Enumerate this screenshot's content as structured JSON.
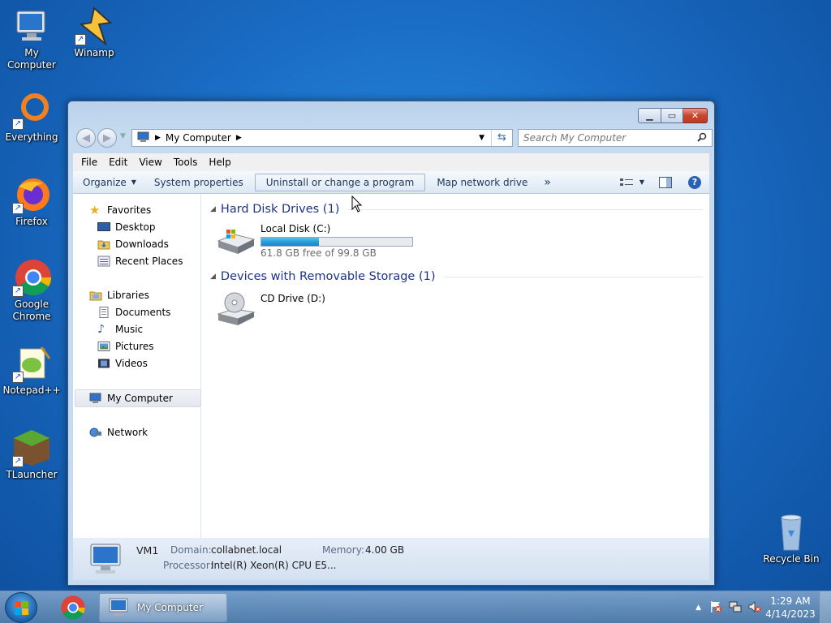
{
  "desktop": {
    "icons": [
      {
        "label": "My Computer"
      },
      {
        "label": "Winamp"
      },
      {
        "label": "Everything"
      },
      {
        "label": "Firefox"
      },
      {
        "label": "Google Chrome"
      },
      {
        "label": "Notepad++"
      },
      {
        "label": "TLauncher"
      },
      {
        "label": "Recycle Bin"
      }
    ]
  },
  "window": {
    "address": {
      "crumb": "My Computer"
    },
    "search": {
      "placeholder": "Search My Computer"
    },
    "menu": [
      "File",
      "Edit",
      "View",
      "Tools",
      "Help"
    ],
    "toolbar": {
      "organize": "Organize",
      "system_properties": "System properties",
      "uninstall": "Uninstall or change a program",
      "map_drive": "Map network drive",
      "more": "»"
    },
    "nav": {
      "favorites": "Favorites",
      "desktop": "Desktop",
      "downloads": "Downloads",
      "recent_places": "Recent Places",
      "libraries": "Libraries",
      "documents": "Documents",
      "music": "Music",
      "pictures": "Pictures",
      "videos": "Videos",
      "my_computer": "My Computer",
      "network": "Network"
    },
    "groups": {
      "hdd_header": "Hard Disk Drives (1)",
      "removable_header": "Devices with Removable Storage (1)"
    },
    "drives": {
      "local": {
        "name": "Local Disk (C:)",
        "free_text": "61.8 GB free of 99.8 GB",
        "used_fraction": 0.38
      },
      "cd": {
        "name": "CD Drive (D:)"
      }
    },
    "details": {
      "name": "VM1",
      "domain_label": "Domain:",
      "domain_value": "collabnet.local",
      "memory_label": "Memory:",
      "memory_value": "4.00 GB",
      "processor_label": "Processor:",
      "processor_value": "Intel(R) Xeon(R) CPU E5..."
    }
  },
  "taskbar": {
    "active_task": "My Computer",
    "time": "1:29 AM",
    "date": "4/14/2023"
  },
  "colors": {
    "accent": "#1e3287",
    "capacity": "#26a0da"
  }
}
